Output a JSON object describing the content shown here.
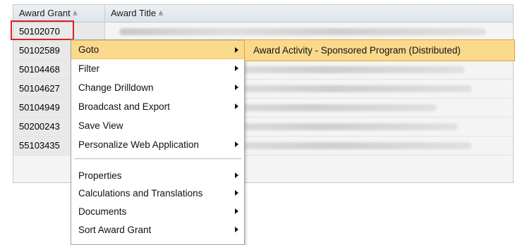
{
  "table": {
    "columns": [
      {
        "label": "Award Grant",
        "sort_icon": "sort-indicator-icon"
      },
      {
        "label": "Award Title",
        "sort_icon": "sort-indicator-icon"
      }
    ],
    "sort_glyph": "≜",
    "rows": [
      {
        "grant": "50102070"
      },
      {
        "grant": "50102589"
      },
      {
        "grant": "50104468"
      },
      {
        "grant": "50104627"
      },
      {
        "grant": "50104949"
      },
      {
        "grant": "50200243"
      },
      {
        "grant": "55103435"
      }
    ]
  },
  "context_menu": {
    "items": [
      {
        "label": "Goto",
        "has_submenu": true,
        "active": true
      },
      {
        "label": "Filter",
        "has_submenu": true
      },
      {
        "label": "Change Drilldown",
        "has_submenu": true
      },
      {
        "label": "Broadcast and Export",
        "has_submenu": true
      },
      {
        "label": "Save View",
        "has_submenu": false
      },
      {
        "label": "Personalize Web Application",
        "has_submenu": true
      },
      {
        "label": "Properties",
        "has_submenu": true
      },
      {
        "label": "Calculations and Translations",
        "has_submenu": true
      },
      {
        "label": "Documents",
        "has_submenu": true
      },
      {
        "label": "Sort Award Grant",
        "has_submenu": true
      }
    ],
    "highlight_color": "#fbd98c"
  },
  "submenu": {
    "items": [
      {
        "label": "Award Activity - Sponsored Program (Distributed)"
      }
    ]
  },
  "colors": {
    "selection_border": "#e02020",
    "menu_highlight": "#fbd98c"
  }
}
